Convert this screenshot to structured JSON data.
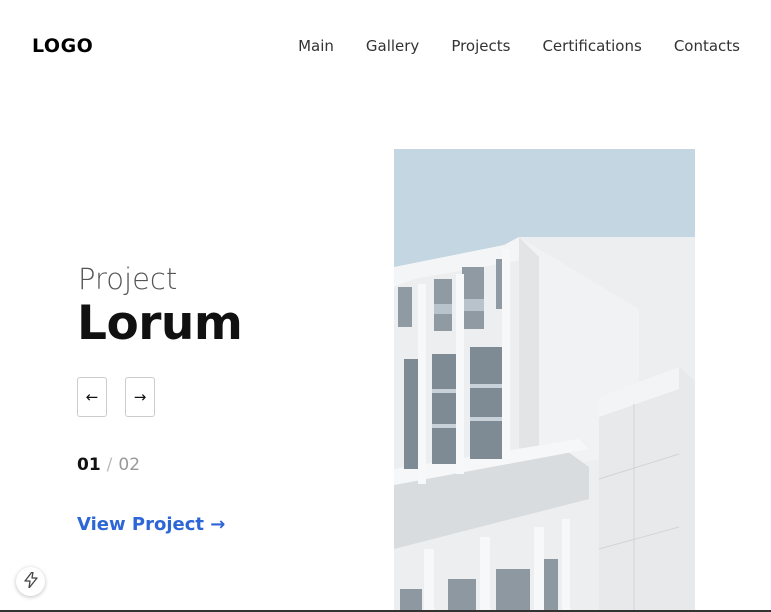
{
  "header": {
    "logo": "LOGO",
    "nav": [
      {
        "label": "Main"
      },
      {
        "label": "Gallery"
      },
      {
        "label": "Projects"
      },
      {
        "label": "Certifications"
      },
      {
        "label": "Contacts"
      }
    ]
  },
  "hero": {
    "subtitle": "Project",
    "title": "Lorum",
    "prev_icon": "←",
    "next_icon": "→",
    "counter": {
      "current": "01",
      "separator": "/",
      "total": "02"
    },
    "cta": "View Project →"
  },
  "colors": {
    "accent": "#2d66d6",
    "sky": "#c3d6e2",
    "building": "#eeeff0"
  },
  "icons": {
    "lightning": "lightning-icon"
  }
}
